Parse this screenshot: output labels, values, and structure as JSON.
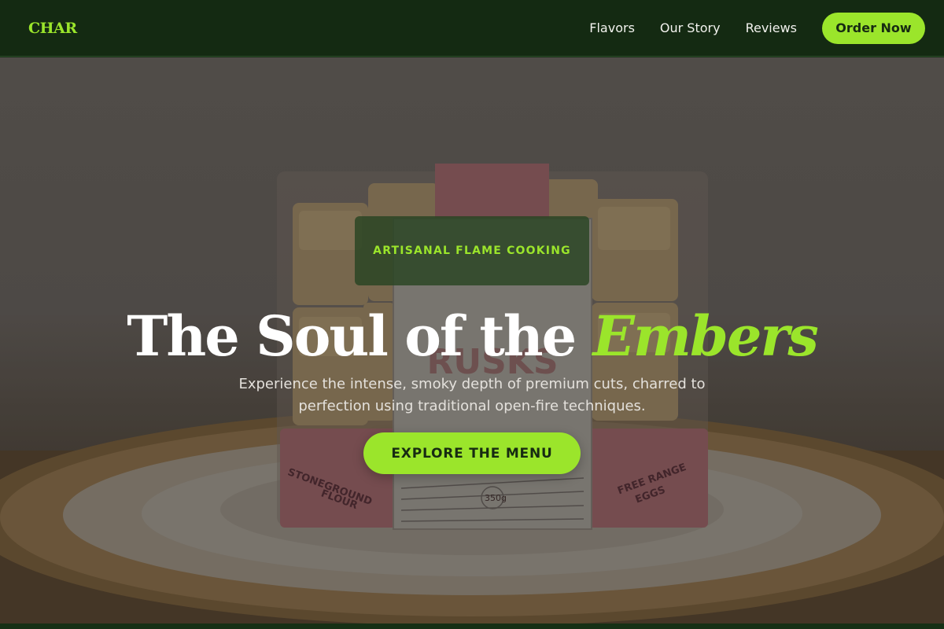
{
  "nav": {
    "logo": "CHAR",
    "links": [
      "Flavors",
      "Our Story",
      "Reviews"
    ],
    "cta_label": "Order Now"
  },
  "hero": {
    "tagline": "ARTISANAL FLAME COOKING",
    "headline_main": "The Soul of the ",
    "headline_accent": "Embers",
    "subtitle": "Experience the intense, smoky depth of premium cuts, charred to perfection using traditional open-fire techniques.",
    "button_label": "EXPLORE THE MENU",
    "image": {
      "package_left_label": "STONEGROUND FLOUR",
      "package_right_label": "FREE RANGE EGGS",
      "package_center_label": "RUSKS",
      "package_weight": "350g"
    }
  },
  "colors": {
    "accent": "#9be52b",
    "nav_background": "#142a12",
    "button_text": "#172b12"
  }
}
